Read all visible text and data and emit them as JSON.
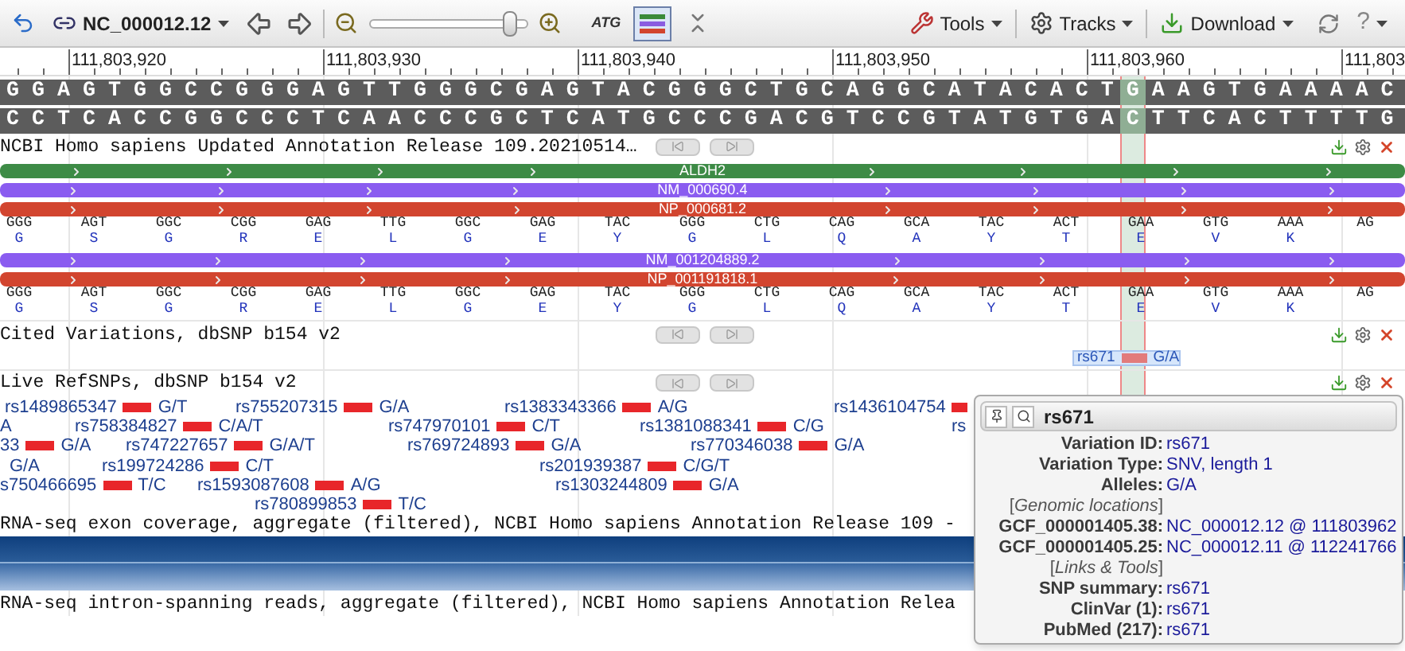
{
  "toolbar": {
    "sequence_id": "NC_000012.12",
    "zoom": {
      "level": 0.93
    },
    "view_buttons": [
      {
        "kind": "text",
        "label": "ATG",
        "selected": false
      },
      {
        "kind": "bars",
        "selected": true
      },
      {
        "kind": "collapse",
        "selected": false
      }
    ],
    "menus": [
      {
        "kind": "tools",
        "label": "Tools"
      },
      {
        "kind": "tracks",
        "label": "Tracks"
      },
      {
        "kind": "download",
        "label": "Download"
      }
    ],
    "help_label": "?"
  },
  "ruler": [
    "111,803,920",
    "111,803,930",
    "111,803,940",
    "111,803,950",
    "111,803,960",
    "111,803"
  ],
  "sequence": [
    {
      "before": "G G A G T G G C C G G G A G T T G G G C G A G T A C G G G C T G C A G G C A T A C A C T",
      "marked": "G",
      "after": "A A G T G A A A A C"
    },
    {
      "before": "C C T C A C C G G C C C T C A A C C C G C T C A T G C C C G A C G T C C G T A T G T G A",
      "marked": "C",
      "after": "T T C A C T T T T G"
    }
  ],
  "tracks": [
    {
      "kind": "genes",
      "title": "NCBI Homo sapiens Updated Annotation Release 109.20210514…",
      "features": [
        {
          "kind": "gene",
          "label": "ALDH2"
        },
        {
          "kind": "rna",
          "label": "NM_000690.4"
        },
        {
          "kind": "protein",
          "label": "NP_000681.2"
        },
        {
          "kind": "codons",
          "codons": [
            {
              "codon": "GGG",
              "aa": "G"
            },
            {
              "codon": "AGT",
              "aa": "S"
            },
            {
              "codon": "GGC",
              "aa": "G"
            },
            {
              "codon": "CGG",
              "aa": "R"
            },
            {
              "codon": "GAG",
              "aa": "E"
            },
            {
              "codon": "TTG",
              "aa": "L"
            },
            {
              "codon": "GGC",
              "aa": "G"
            },
            {
              "codon": "GAG",
              "aa": "E"
            },
            {
              "codon": "TAC",
              "aa": "Y"
            },
            {
              "codon": "GGG",
              "aa": "G"
            },
            {
              "codon": "CTG",
              "aa": "L"
            },
            {
              "codon": "CAG",
              "aa": "Q"
            },
            {
              "codon": "GCA",
              "aa": "A"
            },
            {
              "codon": "TAC",
              "aa": "Y"
            },
            {
              "codon": "ACT",
              "aa": "T"
            },
            {
              "codon": "GAA",
              "aa": "E"
            },
            {
              "codon": "GTG",
              "aa": "V"
            },
            {
              "codon": "AAA",
              "aa": "K"
            },
            {
              "codon": "AG"
            }
          ]
        },
        {
          "kind": "rna",
          "label": "NM_001204889.2"
        },
        {
          "kind": "protein",
          "label": "NP_001191818.1"
        },
        {
          "kind": "codons",
          "codons": [
            {
              "codon": "GGG",
              "aa": "G"
            },
            {
              "codon": "AGT",
              "aa": "S"
            },
            {
              "codon": "GGC",
              "aa": "G"
            },
            {
              "codon": "CGG",
              "aa": "R"
            },
            {
              "codon": "GAG",
              "aa": "E"
            },
            {
              "codon": "TTG",
              "aa": "L"
            },
            {
              "codon": "GGC",
              "aa": "G"
            },
            {
              "codon": "GAG",
              "aa": "E"
            },
            {
              "codon": "TAC",
              "aa": "Y"
            },
            {
              "codon": "GGG",
              "aa": "G"
            },
            {
              "codon": "CTG",
              "aa": "L"
            },
            {
              "codon": "CAG",
              "aa": "Q"
            },
            {
              "codon": "GCA",
              "aa": "A"
            },
            {
              "codon": "TAC",
              "aa": "Y"
            },
            {
              "codon": "ACT",
              "aa": "T"
            },
            {
              "codon": "GAA",
              "aa": "E"
            },
            {
              "codon": "GTG",
              "aa": "V"
            },
            {
              "codon": "AAA",
              "aa": "K"
            },
            {
              "codon": "AG"
            }
          ]
        }
      ]
    },
    {
      "kind": "cited",
      "title": "Cited Variations, dbSNP b154 v2",
      "variant": {
        "id": "rs671",
        "alleles": "G/A",
        "selected": true
      }
    },
    {
      "kind": "snps",
      "title": "Live RefSNPs, dbSNP b154 v2",
      "rows": [
        [
          {
            "kind": "snp",
            "id": "rs1489865347",
            "alleles": "G/T"
          },
          {
            "kind": "snp",
            "id": "rs755207315",
            "alleles": "G/A"
          },
          {
            "kind": "snp",
            "id": "rs1383343366",
            "alleles": "A/G"
          },
          {
            "kind": "snp_cut",
            "id": "rs1436104754"
          }
        ],
        [
          {
            "kind": "text_cut",
            "text": "A"
          },
          {
            "kind": "snp",
            "id": "rs758384827",
            "alleles": "C/A/T"
          },
          {
            "kind": "snp",
            "id": "rs747970101",
            "alleles": "C/T"
          },
          {
            "kind": "snp",
            "id": "rs1381088341",
            "alleles": "C/G"
          },
          {
            "kind": "text_cut",
            "text": "rs"
          }
        ],
        [
          {
            "kind": "snp",
            "id": "33",
            "alleles": "G/A"
          },
          {
            "kind": "snp",
            "id": "rs747227657",
            "alleles": "G/A/T"
          },
          {
            "kind": "snp",
            "id": "rs769724893",
            "alleles": "G/A"
          },
          {
            "kind": "snp",
            "id": "rs770346038",
            "alleles": "G/A"
          }
        ],
        [
          {
            "kind": "text_cut",
            "text": "G/A"
          },
          {
            "kind": "snp",
            "id": "rs199724286",
            "alleles": "C/T"
          },
          {
            "kind": "snp",
            "id": "rs201939387",
            "alleles": "C/G/T"
          }
        ],
        [
          {
            "kind": "snp",
            "id": "s750466695",
            "alleles": "T/C"
          },
          {
            "kind": "snp",
            "id": "rs1593087608",
            "alleles": "A/G"
          },
          {
            "kind": "snp",
            "id": "rs1303244809",
            "alleles": "G/A"
          }
        ],
        [
          {
            "kind": "snp",
            "id": "rs780899853",
            "alleles": "T/C"
          }
        ]
      ]
    },
    {
      "kind": "coverage",
      "title": "RNA-seq exon coverage, aggregate (filtered), NCBI Homo sapiens Annotation Release 109 -"
    },
    {
      "kind": "reads",
      "title": "RNA-seq intron-spanning reads, aggregate (filtered), NCBI Homo sapiens Annotation Relea"
    }
  ],
  "tooltip": {
    "title": "rs671",
    "rows": [
      {
        "kind": "field",
        "label": "Variation ID:",
        "value": "rs671"
      },
      {
        "kind": "field",
        "label": "Variation Type:",
        "value": "SNV, length 1"
      },
      {
        "kind": "field",
        "label": "Alleles:",
        "value": "G/A"
      },
      {
        "kind": "section",
        "text": "[*Genomic locations*]"
      },
      {
        "kind": "link",
        "label": "GCF_000001405.38:",
        "value": "NC_000012.12 @ 111803962"
      },
      {
        "kind": "link",
        "label": "GCF_000001405.25:",
        "value": "NC_000012.11 @ 112241766"
      },
      {
        "kind": "section",
        "text": "[*Links & Tools*]"
      },
      {
        "kind": "link",
        "label": "SNP summary:",
        "value": "rs671"
      },
      {
        "kind": "link",
        "label": "ClinVar (1):",
        "value": "rs671"
      },
      {
        "kind": "link",
        "label": "PubMed (217):",
        "value": "rs671"
      }
    ]
  }
}
